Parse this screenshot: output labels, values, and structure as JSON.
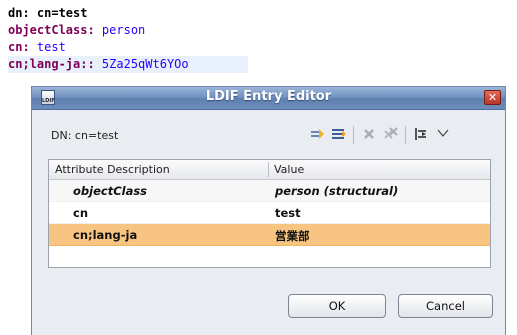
{
  "ldif_source": {
    "lines": [
      {
        "key": "dn:",
        "value": " cn=test"
      },
      {
        "key": "objectClass:",
        "value": " person"
      },
      {
        "key": "cn:",
        "value": " test"
      },
      {
        "key": "cn;lang-ja::",
        "value": " 5Za25qWt6YOo"
      }
    ]
  },
  "dialog": {
    "title": "LDIF Entry Editor",
    "icon_label": "LDIF",
    "close_symbol": "✕",
    "dn_label": "DN: cn=test",
    "toolbar": {
      "icons": [
        "new-value-icon",
        "new-attribute-icon",
        "delete-icon",
        "delete-all-icon",
        "show-raw-values-icon",
        "view-menu-icon"
      ]
    },
    "table": {
      "columns": [
        "Attribute Description",
        "Value"
      ],
      "rows": [
        {
          "description": "objectClass",
          "value": "person (structural)"
        },
        {
          "description": "cn",
          "value": "test"
        },
        {
          "description": "cn;lang-ja",
          "value": "営業部"
        }
      ],
      "selected_row": 2
    },
    "buttons": {
      "ok": "OK",
      "cancel": "Cancel"
    }
  },
  "colors": {
    "title_bar": "#6e8fbd",
    "selection": "#f7c581",
    "close_button": "#c24434"
  }
}
